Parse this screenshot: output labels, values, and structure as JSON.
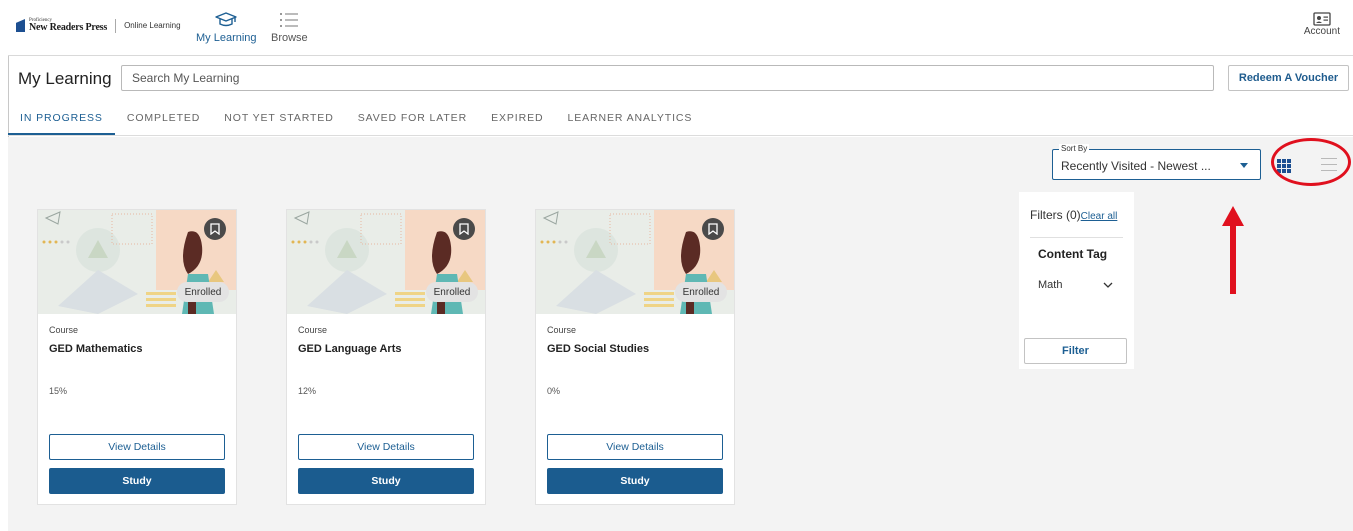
{
  "brand": {
    "pre": "Proficiency",
    "name": "New Readers Press",
    "sub": "Online Learning"
  },
  "nav": {
    "my_learning": "My Learning",
    "browse": "Browse",
    "account": "Account"
  },
  "header": {
    "title": "My Learning",
    "search_placeholder": "Search My Learning",
    "voucher_label": "Redeem A Voucher"
  },
  "tabs": [
    {
      "label": "IN PROGRESS",
      "active": true
    },
    {
      "label": "COMPLETED"
    },
    {
      "label": "NOT YET STARTED"
    },
    {
      "label": "SAVED FOR LATER"
    },
    {
      "label": "EXPIRED"
    },
    {
      "label": "LEARNER ANALYTICS"
    }
  ],
  "sort": {
    "label": "Sort By",
    "value": "Recently Visited - Newest ..."
  },
  "cards": [
    {
      "type": "Course",
      "title": "GED Mathematics",
      "progress": "15%",
      "badge": "Enrolled",
      "details_label": "View Details",
      "study_label": "Study"
    },
    {
      "type": "Course",
      "title": "GED Language Arts",
      "progress": "12%",
      "badge": "Enrolled",
      "details_label": "View Details",
      "study_label": "Study"
    },
    {
      "type": "Course",
      "title": "GED Social Studies",
      "progress": "0%",
      "badge": "Enrolled",
      "details_label": "View Details",
      "study_label": "Study"
    }
  ],
  "filters": {
    "heading": "Filters (0)",
    "clear_all": "Clear all",
    "section": "Content Tag",
    "option": "Math",
    "button": "Filter"
  },
  "colors": {
    "accent": "#1d5f93",
    "annotation": "#e0101e"
  }
}
